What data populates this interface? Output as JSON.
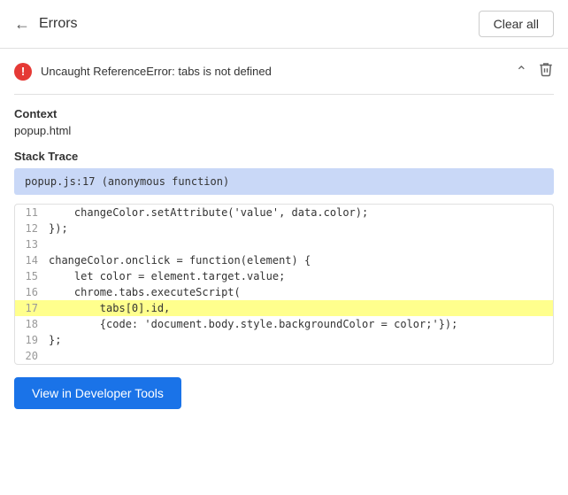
{
  "header": {
    "back_label": "←",
    "title": "Errors",
    "clear_all_label": "Clear all"
  },
  "error": {
    "icon_label": "!",
    "message": "Uncaught ReferenceError: tabs is not defined"
  },
  "context": {
    "label": "Context",
    "value": "popup.html"
  },
  "stack_trace": {
    "label": "Stack Trace",
    "value": "popup.js:17 (anonymous function)"
  },
  "code_lines": [
    {
      "num": "11",
      "code": "    changeColor.setAttribute('value', data.color);",
      "highlighted": false
    },
    {
      "num": "12",
      "code": "});",
      "highlighted": false
    },
    {
      "num": "13",
      "code": "",
      "highlighted": false
    },
    {
      "num": "14",
      "code": "changeColor.onclick = function(element) {",
      "highlighted": false
    },
    {
      "num": "15",
      "code": "    let color = element.target.value;",
      "highlighted": false
    },
    {
      "num": "16",
      "code": "    chrome.tabs.executeScript(",
      "highlighted": false
    },
    {
      "num": "17",
      "code": "        tabs[0].id,",
      "highlighted": true
    },
    {
      "num": "18",
      "code": "        {code: 'document.body.style.backgroundColor = color;'});",
      "highlighted": false
    },
    {
      "num": "19",
      "code": "};",
      "highlighted": false
    },
    {
      "num": "20",
      "code": "",
      "highlighted": false
    }
  ],
  "dev_tools_btn_label": "View in Developer Tools"
}
